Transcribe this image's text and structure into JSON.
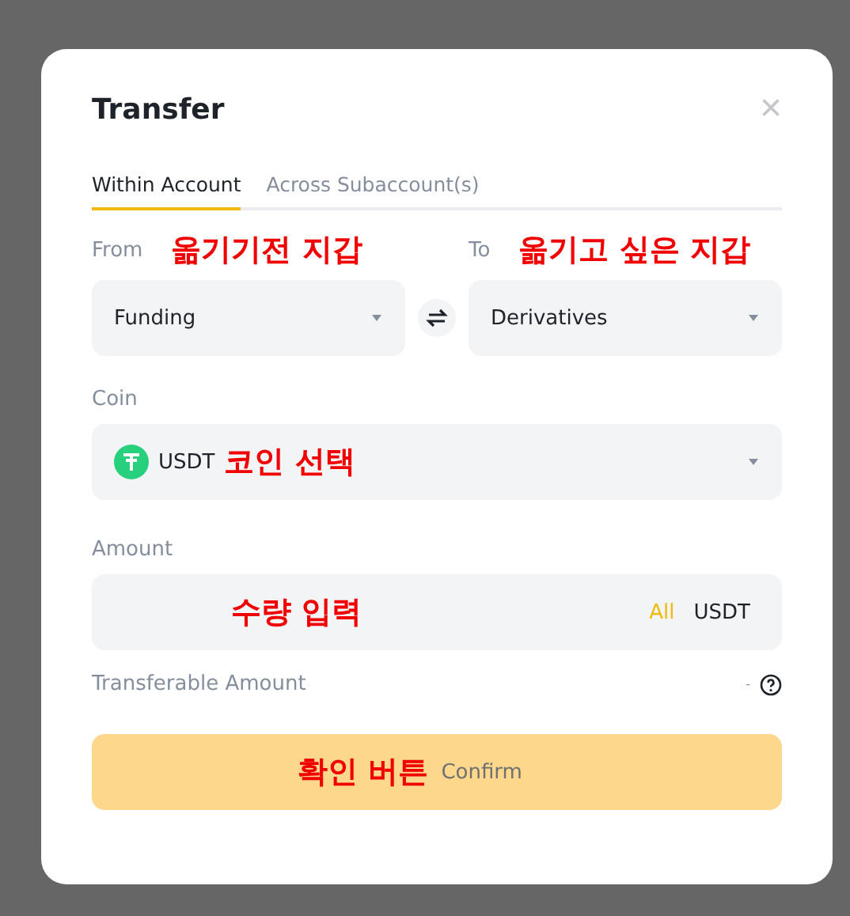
{
  "dialog": {
    "title": "Transfer",
    "close": "×"
  },
  "tabs": [
    {
      "label": "Within Account",
      "selected": true
    },
    {
      "label": "Across Subaccount(s)",
      "selected": false
    }
  ],
  "from": {
    "label": "From",
    "annotation": "옮기기전 지갑",
    "value": "Funding"
  },
  "to": {
    "label": "To",
    "annotation": "옮기고 싶은 지갑",
    "value": "Derivatives"
  },
  "coin": {
    "label": "Coin",
    "value": "USDT",
    "annotation": "코인 선택"
  },
  "amount": {
    "label": "Amount",
    "annotation": "수량 입력",
    "all": "All",
    "unit": "USDT"
  },
  "transferable": {
    "label": "Transferable Amount",
    "value": "-"
  },
  "confirm": {
    "label": "Confirm",
    "annotation": "확인 버튼",
    "disabled": true
  }
}
